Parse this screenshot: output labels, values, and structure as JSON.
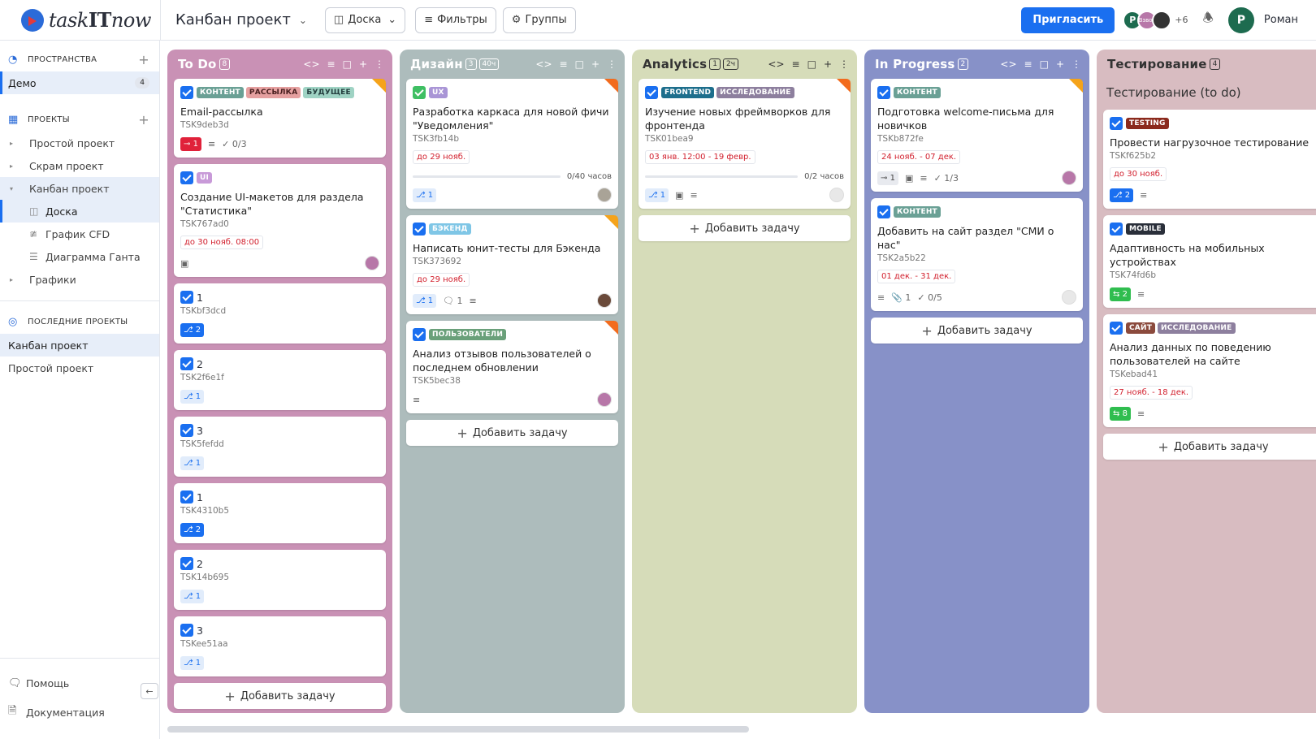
{
  "app": {
    "logo_text_a": "task",
    "logo_text_b": "IT",
    "logo_text_c": "now",
    "project_title": "Канбан проект",
    "view_button": "Доска",
    "filters_button": "Фильтры",
    "groups_button": "Группы",
    "invite_button": "Пригласить",
    "avatar_initial": "Р",
    "avatar_small_label": "Взвол",
    "more_users": "+6",
    "user_initial": "Р",
    "user_name": "Роман"
  },
  "sidebar": {
    "spaces_header": "ПРОСТРАНСТВА",
    "space_item": "Демо",
    "space_count": "4",
    "projects_header": "ПРОЕКТЫ",
    "projects": [
      "Простой проект",
      "Скрам проект",
      "Канбан проект"
    ],
    "kanban_children": [
      "Доска",
      "График CFD",
      "Диаграмма Ганта"
    ],
    "charts_item": "Графики",
    "recent_header": "ПОСЛЕДНИЕ ПРОЕКТЫ",
    "recent": [
      "Канбан проект",
      "Простой проект"
    ],
    "help": "Помощь",
    "docs": "Документация"
  },
  "columns": {
    "todo": {
      "title": "To Do",
      "count": "8",
      "color": "#c991b5"
    },
    "design": {
      "title": "Дизайн",
      "count": "3",
      "hours": "40ч",
      "color": "#adbcbc"
    },
    "analytics": {
      "title": "Analytics",
      "count": "1",
      "hours": "2ч",
      "color": "#d6dcb9"
    },
    "progress": {
      "title": "In Progress",
      "count": "2",
      "color": "#8791c8"
    },
    "testing": {
      "title": "Тестирование",
      "count": "4",
      "subtitle": "Тестирование (to do)",
      "color": "#d8bcc1"
    }
  },
  "add_task": "Добавить задачу",
  "cards": {
    "t1": {
      "tags": [
        "КОНТЕНТ",
        "РАССЫЛКА",
        "БУДУЩЕЕ"
      ],
      "title": "Email-рассылка",
      "id": "TSK9deb3d",
      "blockers": "1",
      "checklist": "0/3"
    },
    "t2": {
      "tag": "UI",
      "title": "Создание UI-макетов для раздела \"Статистика\"",
      "id": "TSK767ad0",
      "date": "до 30 нояб. 08:00"
    },
    "t3": {
      "title": "1",
      "id": "TSKbf3dcd",
      "subtasks": "2"
    },
    "t4": {
      "title": "2",
      "id": "TSK2f6e1f",
      "subtasks": "1"
    },
    "t5": {
      "title": "3",
      "id": "TSK5fefdd",
      "subtasks": "1"
    },
    "t6": {
      "title": "1",
      "id": "TSK4310b5",
      "subtasks": "2"
    },
    "t7": {
      "title": "2",
      "id": "TSK14b695",
      "subtasks": "1"
    },
    "t8": {
      "title": "3",
      "id": "TSKee51aa",
      "subtasks": "1"
    },
    "d1": {
      "tag": "UX",
      "title": "Разработка каркаса для новой фичи \"Уведомления\"",
      "id": "TSK3fb14b",
      "date": "до 29 нояб.",
      "progress": "0/40 часов",
      "subtasks": "1"
    },
    "d2": {
      "tag": "БЭКЕНД",
      "title": "Написать юнит-тесты для Бэкенда",
      "id": "TSK373692",
      "date": "до 29 нояб.",
      "subtasks": "1",
      "comments": "1"
    },
    "d3": {
      "tag": "ПОЛЬЗОВАТЕЛИ",
      "title": "Анализ отзывов пользователей о последнем обновлении",
      "id": "TSK5bec38"
    },
    "a1": {
      "tags": [
        "FRONTEND",
        "ИССЛЕДОВАНИЕ"
      ],
      "title": "Изучение новых фреймворков для фронтенда",
      "id": "TSK01bea9",
      "date": "03 янв. 12:00 - 19 февр.",
      "progress": "0/2 часов",
      "subtasks": "1"
    },
    "p1": {
      "tag": "КОНТЕНТ",
      "title": "Подготовка welcome-письма для новичков",
      "id": "TSKb872fe",
      "date": "24 нояб. - 07 дек.",
      "links": "1",
      "checklist": "1/3"
    },
    "p2": {
      "tag": "КОНТЕНТ",
      "title": "Добавить на сайт раздел \"СМИ о нас\"",
      "id": "TSK2a5b22",
      "date": "01 дек. - 31 дек.",
      "attach": "1",
      "checklist": "0/5"
    },
    "s1": {
      "tag": "TESTING",
      "title": "Провести нагрузочное тестирование",
      "id": "TSKf625b2",
      "date": "до 30 нояб.",
      "subtasks": "2"
    },
    "s2": {
      "tag": "MOBILE",
      "title": "Адаптивность на мобильных устройствах",
      "id": "TSK74fd6b",
      "linked": "2"
    },
    "s3": {
      "tags": [
        "САЙТ",
        "ИССЛЕДОВАНИЕ"
      ],
      "title": "Анализ данных по поведению пользователей на сайте",
      "id": "TSKebad41",
      "date": "27 нояб. - 18 дек.",
      "linked": "8"
    }
  }
}
